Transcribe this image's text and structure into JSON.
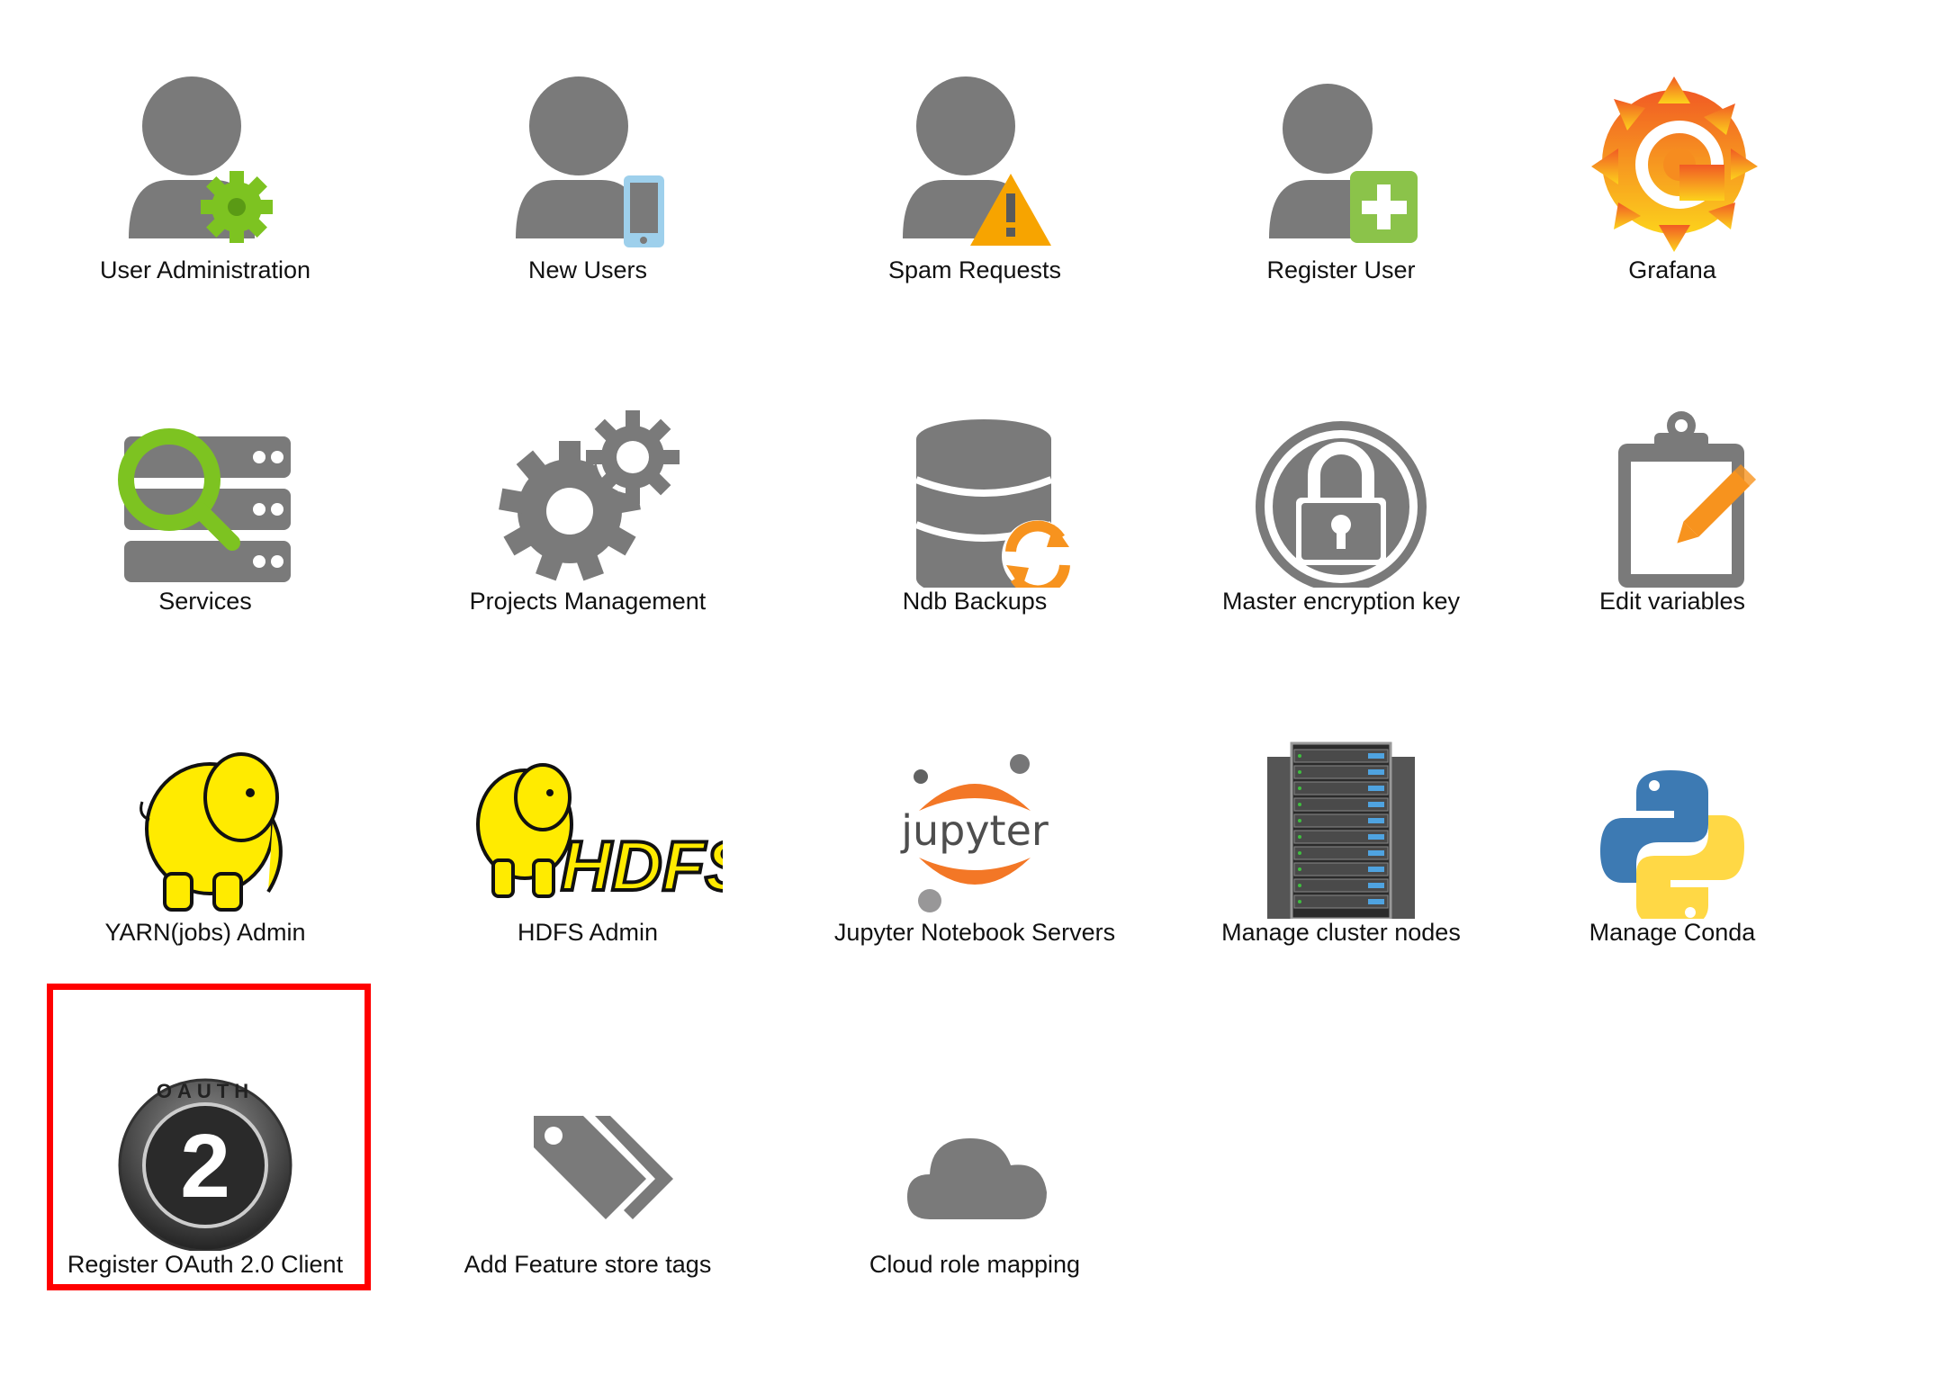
{
  "tiles": [
    {
      "label": "User Administration"
    },
    {
      "label": "New Users"
    },
    {
      "label": "Spam Requests"
    },
    {
      "label": "Register User"
    },
    {
      "label": "Grafana"
    },
    {
      "label": "Services"
    },
    {
      "label": "Projects Management"
    },
    {
      "label": "Ndb Backups"
    },
    {
      "label": "Master encryption key"
    },
    {
      "label": "Edit variables"
    },
    {
      "label": "YARN(jobs) Admin"
    },
    {
      "label": "HDFS Admin"
    },
    {
      "label": "Jupyter Notebook Servers"
    },
    {
      "label": "Manage cluster nodes"
    },
    {
      "label": "Manage Conda"
    },
    {
      "label": "Register OAuth 2.0 Client"
    },
    {
      "label": "Add Feature store tags"
    },
    {
      "label": "Cloud role mapping"
    }
  ],
  "icon_text": {
    "hdfs": "HDFS",
    "jupyter": "jupyter",
    "oauth_number": "2",
    "oauth_word": "OAUTH"
  },
  "colors": {
    "icon_gray": "#7a7a7a",
    "green": "#7dc321",
    "orange": "#f7931e",
    "highlight": "#ff0000"
  }
}
